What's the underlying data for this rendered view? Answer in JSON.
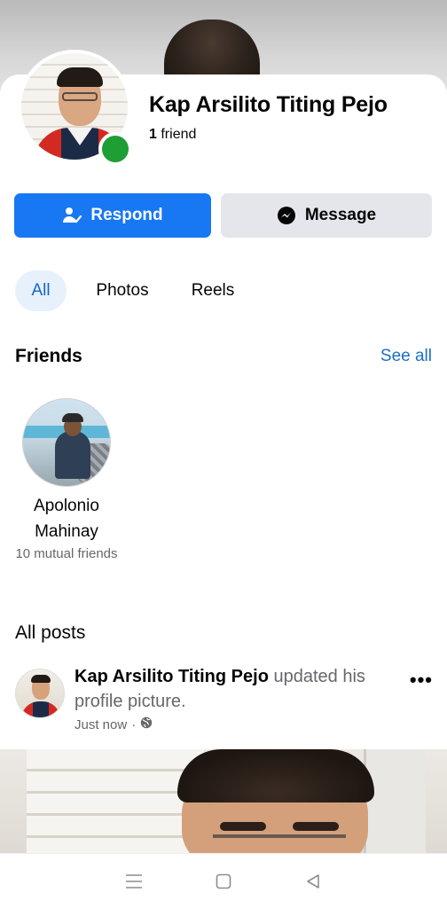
{
  "profile": {
    "name": "Kap Arsilito Titing Pejo",
    "friend_count": "1",
    "friend_label": "friend",
    "online": true
  },
  "actions": {
    "respond_label": "Respond",
    "message_label": "Message"
  },
  "tabs": [
    {
      "label": "All",
      "active": true
    },
    {
      "label": "Photos",
      "active": false
    },
    {
      "label": "Reels",
      "active": false
    }
  ],
  "friends_section": {
    "title": "Friends",
    "see_all": "See all",
    "items": [
      {
        "name": "Apolonio Mahinay",
        "mutual": "10 mutual friends"
      }
    ]
  },
  "posts_section": {
    "title": "All posts",
    "posts": [
      {
        "author": "Kap Arsilito Titing Pejo",
        "action": "updated his profile picture.",
        "time": "Just now",
        "privacy_icon": "globe-icon",
        "more": "•••"
      }
    ]
  },
  "colors": {
    "primary": "#1877f2",
    "link": "#1a6fc4",
    "online": "#1d9f34",
    "secondary_button": "#e4e6eb",
    "active_tab_bg": "#e7f1fc"
  },
  "navbar_icons": [
    "menu-icon",
    "home-square-icon",
    "back-triangle-icon"
  ]
}
